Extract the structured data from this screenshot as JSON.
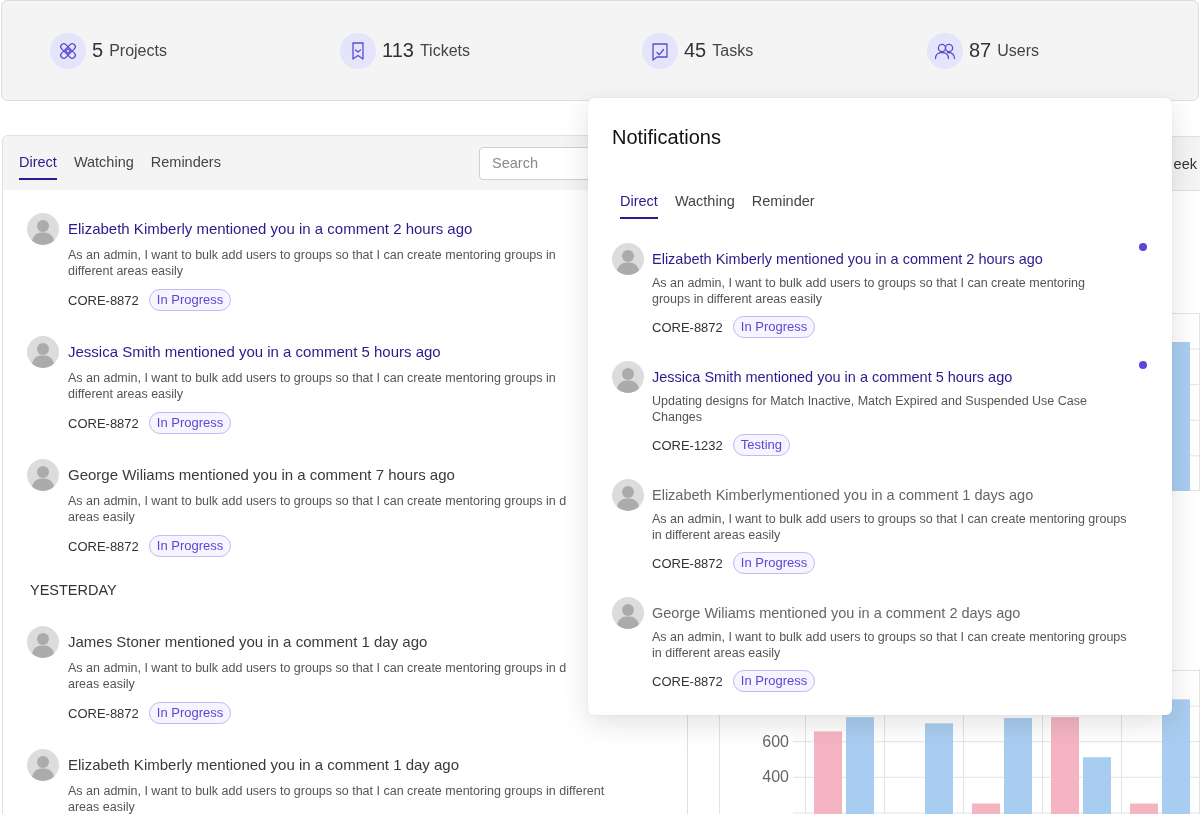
{
  "stats": [
    {
      "kind": "projects",
      "count": "5",
      "label": "Projects"
    },
    {
      "kind": "tickets",
      "count": "113",
      "label": "Tickets"
    },
    {
      "kind": "tasks",
      "count": "45",
      "label": "Tasks"
    },
    {
      "kind": "users",
      "count": "87",
      "label": "Users"
    }
  ],
  "feed": {
    "tabs": [
      {
        "label": "Direct",
        "selected": true
      },
      {
        "label": "Watching",
        "selected": false
      },
      {
        "label": "Reminders",
        "selected": false
      }
    ],
    "search": {
      "placeholder": "Search"
    },
    "sections": [
      {
        "items": [
          {
            "title": "Elizabeth Kimberly mentioned you in a comment 2 hours ago",
            "unread": true,
            "description": "As an admin, I want to bulk add users to groups so that I can create mentoring groups in\ndifferent areas easily",
            "ticket": "CORE-8872",
            "status": "In Progress"
          },
          {
            "title": "Jessica Smith mentioned you in a comment 5 hours ago",
            "unread": true,
            "description": "As an admin, I want to bulk add users to groups so that I can create mentoring groups in\ndifferent areas easily",
            "ticket": "CORE-8872",
            "status": "In Progress"
          },
          {
            "title": "George Wiliams mentioned you in a comment 7 hours ago",
            "unread": false,
            "description": "As an admin, I want to bulk add users to groups so that I can create mentoring groups in d\nareas easily",
            "ticket": "CORE-8872",
            "status": "In Progress"
          }
        ]
      },
      {
        "heading": "YESTERDAY",
        "items": [
          {
            "title": "James Stoner mentioned you in a comment 1 day ago",
            "unread": false,
            "description": "As an admin, I want to bulk add users to groups so that I can create mentoring groups in d\nareas easily",
            "ticket": "CORE-8872",
            "status": "In Progress"
          },
          {
            "title": "Elizabeth Kimberly mentioned you in a comment 1 day ago",
            "unread": false,
            "description": "As an admin, I want to bulk add users to groups so that I can create mentoring groups in different\nareas easily"
          }
        ]
      }
    ]
  },
  "chart_panel": {
    "header_text": "eek",
    "chart_data": {
      "type": "bar",
      "ylim": [
        0,
        1000
      ],
      "yticks": [
        400,
        600
      ],
      "grid": true,
      "series": [
        {
          "color": "#f5b4c2",
          "values": [
            655,
            null,
            250,
            735,
            250
          ]
        },
        {
          "color": "#a9cdf0",
          "values": [
            735,
            700,
            730,
            510,
            835
          ]
        }
      ]
    }
  },
  "notifications": {
    "title": "Notifications",
    "tabs": [
      {
        "label": "Direct",
        "selected": true
      },
      {
        "label": "Wacthing",
        "selected": false
      },
      {
        "label": "Reminder",
        "selected": false
      }
    ],
    "items": [
      {
        "title": "Elizabeth Kimberly mentioned you in a comment 2 hours ago",
        "unread": true,
        "description": "As an admin, I want to bulk add users to groups so that I can create mentoring\ngroups in different areas easily",
        "ticket": "CORE-8872",
        "status": "In Progress"
      },
      {
        "title": "Jessica Smith mentioned you in a comment 5 hours ago",
        "unread": true,
        "description": "Updating designs for Match Inactive, Match Expired and Suspended Use Case\nChanges",
        "ticket": "CORE-1232",
        "status": "Testing"
      },
      {
        "title": "Elizabeth Kimberlymentioned you in a comment 1 days ago",
        "unread": false,
        "description": "As an admin, I want to bulk add users to groups so that I can create mentoring groups\nin different areas easily",
        "ticket": "CORE-8872",
        "status": "In Progress"
      },
      {
        "title": "George Wiliams mentioned you in a comment 2 days ago",
        "unread": false,
        "description": "As an admin, I want to bulk add users to groups so that I can create mentoring groups\nin different areas easily",
        "ticket": "CORE-8872",
        "status": "In Progress"
      }
    ]
  }
}
